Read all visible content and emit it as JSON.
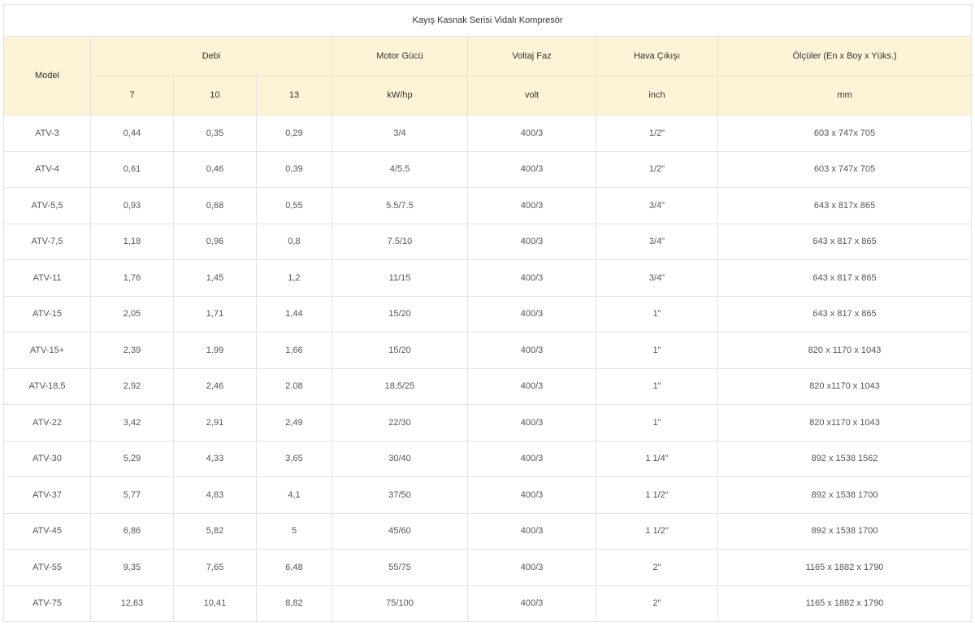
{
  "title": "Kayış Kasnak Serisi Vidalı Kompresör",
  "header": {
    "model": "Model",
    "debi": "Debi",
    "motor": "Motor Gücü",
    "voltaj": "Voltaj Faz",
    "hava": "Hava Çıkışı",
    "olculer": "Ölçüler (En x Boy x Yüks.)",
    "debi_sub": [
      "7",
      "10",
      "13"
    ],
    "motor_unit": "kW/hp",
    "voltaj_unit": "volt",
    "hava_unit": "inch",
    "olculer_unit": "mm"
  },
  "rows": [
    [
      "ATV-3",
      "0,44",
      "0,35",
      "0,29",
      "3/4",
      "400/3",
      "1/2\"",
      "603 x 747x 705"
    ],
    [
      "ATV-4",
      "0,61",
      "0,46",
      "0,39",
      "4/5.5",
      "400/3",
      "1/2\"",
      "603 x 747x 705"
    ],
    [
      "ATV-5,5",
      "0,93",
      "0,68",
      "0,55",
      "5.5/7.5",
      "400/3",
      "3/4\"",
      "643 x 817x 865"
    ],
    [
      "ATV-7,5",
      "1,18",
      "0,96",
      "0,8",
      "7.5/10",
      "400/3",
      "3/4\"",
      "643 x 817 x 865"
    ],
    [
      "ATV-11",
      "1,76",
      "1,45",
      "1,2",
      "11/15",
      "400/3",
      "3/4\"",
      "643 x 817 x 865"
    ],
    [
      "ATV-15",
      "2,05",
      "1,71",
      "1,44",
      "15/20",
      "400/3",
      "1\"",
      "643 x 817 x 865"
    ],
    [
      "ATV-15+",
      "2,39",
      "1.99",
      "1,66",
      "15/20",
      "400/3",
      "1\"",
      "820 x 1170 x 1043"
    ],
    [
      "ATV-18,5",
      "2,92",
      "2,46",
      "2.08",
      "18,5/25",
      "400/3",
      "1\"",
      "820 x1170 x 1043"
    ],
    [
      "ATV-22",
      "3,42",
      "2,91",
      "2,49",
      "22/30",
      "400/3",
      "1\"",
      "820 x1170 x 1043"
    ],
    [
      "ATV-30",
      "5,29",
      "4,33",
      "3,65",
      "30/40",
      "400/3",
      "1 1/4\"",
      "892 x 1538 1562"
    ],
    [
      "ATV-37",
      "5,77",
      "4,83",
      "4,1",
      "37/50",
      "400/3",
      "1 1/2\"",
      "892 x 1538 1700"
    ],
    [
      "ATV-45",
      "6,86",
      "5,82",
      "5",
      "45/60",
      "400/3",
      "1 1/2\"",
      "892 x 1538 1700"
    ],
    [
      "ATV-55",
      "9,35",
      "7,65",
      "6,48",
      "55/75",
      "400/3",
      "2\"",
      "1165 x 1882 x 1790"
    ],
    [
      "ATV-75",
      "12,63",
      "10,41",
      "8,82",
      "75/100",
      "400/3",
      "2\"",
      "1165 x 1882 x 1790"
    ]
  ]
}
